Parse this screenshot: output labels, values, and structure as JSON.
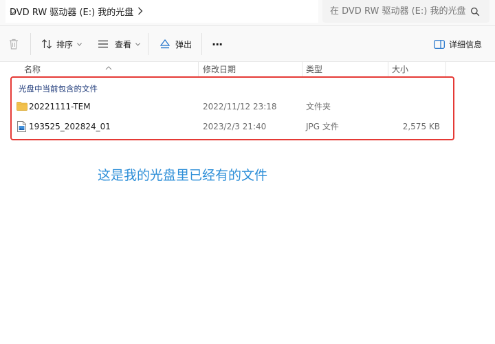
{
  "addressbar": {
    "breadcrumb": "DVD RW 驱动器 (E:) 我的光盘",
    "search_placeholder": "在 DVD RW 驱动器 (E:) 我的光盘"
  },
  "toolbar": {
    "sort_label": "排序",
    "view_label": "查看",
    "eject_label": "弹出",
    "more_label": "···",
    "details_label": "详细信息"
  },
  "columns": {
    "name": "名称",
    "modified": "修改日期",
    "type": "类型",
    "size": "大小"
  },
  "group": {
    "label": "光盘中当前包含的文件"
  },
  "files": [
    {
      "name": "20221111-TEM",
      "modified": "2022/11/12 23:18",
      "type": "文件夹",
      "size": "",
      "icon": "folder-icon"
    },
    {
      "name": "193525_202824_01",
      "modified": "2023/2/3 21:40",
      "type": "JPG 文件",
      "size": "2,575 KB",
      "icon": "image-file-icon"
    }
  ],
  "annotation": "这是我的光盘里已经有的文件",
  "colors": {
    "highlight": "#e53935",
    "annotation": "#2e8fd8",
    "folder": "#f2c14e",
    "group_text": "#1e3a7a"
  }
}
